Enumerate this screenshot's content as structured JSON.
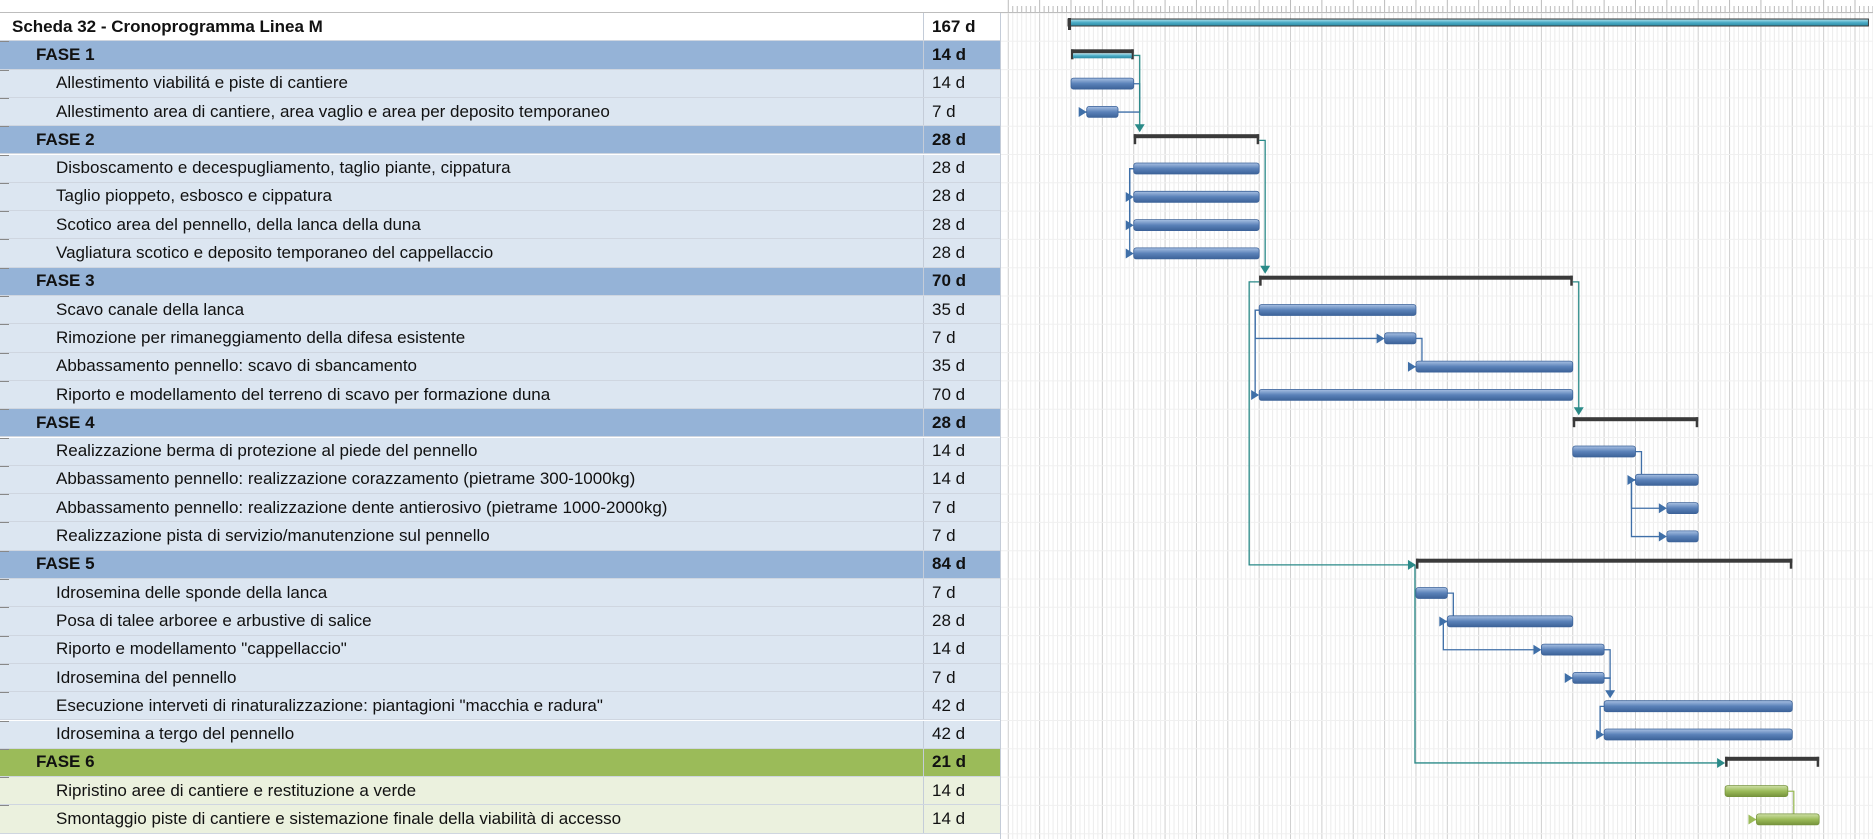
{
  "colors": {
    "phase_blue_bg": "#95b3d7",
    "task_blue_bg": "#dce6f1",
    "phase_green_bg": "#9bbb59",
    "task_green_bg": "#ebf1de",
    "bar_blue": "#5b82b9",
    "bar_green": "#9bbb59",
    "summary_black": "#3a3a3a",
    "project_teal": "#4bacc6",
    "link_blue": "#3f6fa8",
    "link_teal": "#2a8a88",
    "grid": "#d9d9d9"
  },
  "timeline_weeks": 24,
  "project": {
    "name": "Scheda 32 - Cronoprogramma Linea M",
    "duration": "167 d"
  },
  "rows": [
    {
      "kind": "phase",
      "group": "blue",
      "name": "FASE 1",
      "duration": "14 d",
      "start": 0,
      "length": 14
    },
    {
      "kind": "task",
      "group": "blue",
      "name": "Allestimento viabilitá e piste di cantiere",
      "duration": "14 d",
      "start": 0,
      "length": 14
    },
    {
      "kind": "task",
      "group": "blue",
      "name": "Allestimento area di cantiere, area vaglio e area per deposito temporaneo",
      "duration": "7 d",
      "start": 3.5,
      "length": 7
    },
    {
      "kind": "phase",
      "group": "blue",
      "name": "FASE 2",
      "duration": "28 d",
      "start": 14,
      "length": 28
    },
    {
      "kind": "task",
      "group": "blue",
      "name": "Disboscamento e decespugliamento, taglio piante, cippatura",
      "duration": "28 d",
      "start": 14,
      "length": 28
    },
    {
      "kind": "task",
      "group": "blue",
      "name": "Taglio pioppeto, esbosco e cippatura",
      "duration": "28 d",
      "start": 14,
      "length": 28
    },
    {
      "kind": "task",
      "group": "blue",
      "name": "Scotico area del pennello, della lanca della duna",
      "duration": "28 d",
      "start": 14,
      "length": 28
    },
    {
      "kind": "task",
      "group": "blue",
      "name": "Vagliatura scotico e deposito temporaneo del cappellaccio",
      "duration": "28 d",
      "start": 14,
      "length": 28
    },
    {
      "kind": "phase",
      "group": "blue",
      "name": "FASE 3",
      "duration": "70 d",
      "start": 42,
      "length": 70
    },
    {
      "kind": "task",
      "group": "blue",
      "name": "Scavo canale della lanca",
      "duration": "35 d",
      "start": 42,
      "length": 35
    },
    {
      "kind": "task",
      "group": "blue",
      "name": "Rimozione per rimaneggiamento della difesa esistente",
      "duration": "7 d",
      "start": 70,
      "length": 7
    },
    {
      "kind": "task",
      "group": "blue",
      "name": "Abbassamento pennello: scavo di sbancamento",
      "duration": "35 d",
      "start": 77,
      "length": 35
    },
    {
      "kind": "task",
      "group": "blue",
      "name": "Riporto e modellamento del terreno di scavo per formazione duna",
      "duration": "70 d",
      "start": 42,
      "length": 70
    },
    {
      "kind": "phase",
      "group": "blue",
      "name": "FASE 4",
      "duration": "28 d",
      "start": 112,
      "length": 28
    },
    {
      "kind": "task",
      "group": "blue",
      "name": "Realizzazione berma di protezione al piede del pennello",
      "duration": "14 d",
      "start": 112,
      "length": 14
    },
    {
      "kind": "task",
      "group": "blue",
      "name": "Abbassamento pennello: realizzazione corazzamento (pietrame 300-1000kg)",
      "duration": "14 d",
      "start": 126,
      "length": 14
    },
    {
      "kind": "task",
      "group": "blue",
      "name": "Abbassamento pennello: realizzazione dente antierosivo (pietrame 1000-2000kg)",
      "duration": "7 d",
      "start": 133,
      "length": 7
    },
    {
      "kind": "task",
      "group": "blue",
      "name": "Realizzazione pista di servizio/manutenzione sul pennello",
      "duration": "7 d",
      "start": 133,
      "length": 7
    },
    {
      "kind": "phase",
      "group": "blue",
      "name": "FASE 5",
      "duration": "84 d",
      "start": 77,
      "length": 84
    },
    {
      "kind": "task",
      "group": "blue",
      "name": "Idrosemina delle sponde della lanca",
      "duration": "7 d",
      "start": 77,
      "length": 7
    },
    {
      "kind": "task",
      "group": "blue",
      "name": "Posa di talee arboree e arbustive di salice",
      "duration": "28 d",
      "start": 84,
      "length": 28
    },
    {
      "kind": "task",
      "group": "blue",
      "name": "Riporto e modellamento \"cappellaccio\"",
      "duration": "14 d",
      "start": 105,
      "length": 14
    },
    {
      "kind": "task",
      "group": "blue",
      "name": "Idrosemina del pennello",
      "duration": "7 d",
      "start": 112,
      "length": 7
    },
    {
      "kind": "task",
      "group": "blue",
      "name": "Esecuzione interveti di rinaturalizzazione: piantagioni \"macchia e radura\"",
      "duration": "42 d",
      "start": 119,
      "length": 42
    },
    {
      "kind": "task",
      "group": "blue",
      "name": "Idrosemina a tergo del pennello",
      "duration": "42 d",
      "start": 119,
      "length": 42
    },
    {
      "kind": "phase",
      "group": "green",
      "name": "FASE 6",
      "duration": "21 d",
      "start": 146,
      "length": 21
    },
    {
      "kind": "task",
      "group": "green",
      "name": "Ripristino aree di cantiere e restituzione a verde",
      "duration": "14 d",
      "start": 146,
      "length": 14
    },
    {
      "kind": "task",
      "group": "green",
      "name": "Smontaggio piste di cantiere e sistemazione finale della viabilità di accesso",
      "duration": "14 d",
      "start": 153,
      "length": 14
    }
  ]
}
